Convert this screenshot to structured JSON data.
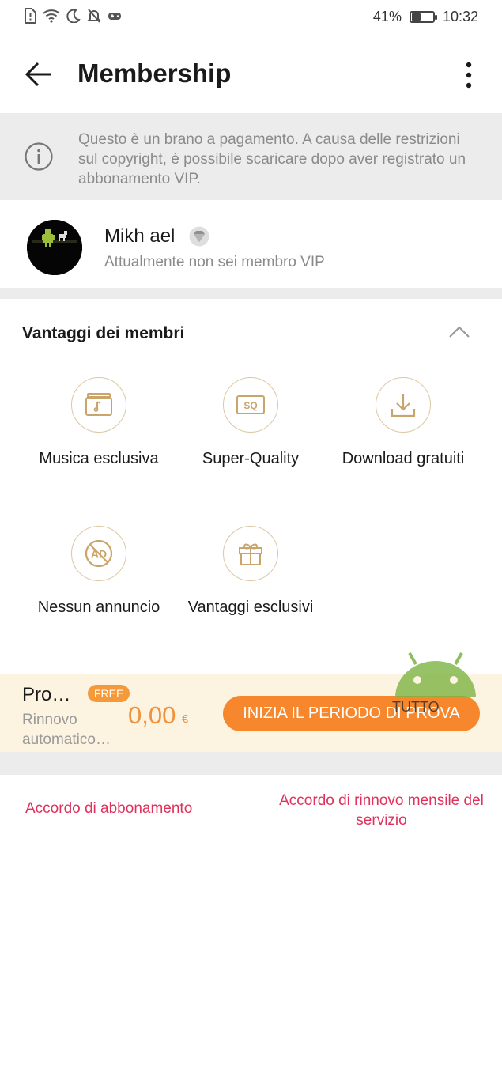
{
  "status_bar": {
    "battery_percent": "41%",
    "battery_level": 0.41,
    "time": "10:32"
  },
  "header": {
    "title": "Membership",
    "back_icon": "arrow-left-icon",
    "more_icon": "more-vertical-icon"
  },
  "notice": {
    "icon": "info-icon",
    "text": "Questo è un brano a pagamento. A causa delle restrizioni sul copyright, è possibile scaricare dopo aver registrato un abbonamento VIP."
  },
  "profile": {
    "name": "Mikh ael",
    "status": "Attualmente non sei membro VIP"
  },
  "benefits": {
    "title": "Vantaggi dei membri",
    "accent_color": "#c9a46b",
    "items": [
      {
        "label": "Musica esclusiva",
        "icon": "exclusive-music-icon"
      },
      {
        "label": "Super-Quality",
        "icon": "sq-icon"
      },
      {
        "label": "Download gratuiti",
        "icon": "download-icon"
      },
      {
        "label": "Nessun annuncio",
        "icon": "no-ads-icon"
      },
      {
        "label": "Vantaggi esclusivi",
        "icon": "gift-icon"
      }
    ]
  },
  "promo": {
    "plan_name": "Pro…",
    "badge": "FREE",
    "renewal": "Rinnovo automatico…",
    "price": "0,00",
    "currency": "€",
    "cta": "INIZIA IL PERIODO DI PROVA",
    "cta_color": "#f7872c"
  },
  "watermark": {
    "text": "TUTTO"
  },
  "links": {
    "subscription_agreement": "Accordo di abbonamento",
    "renewal_agreement": "Accordo di rinnovo mensile del servizio",
    "link_color": "#e0315c"
  }
}
